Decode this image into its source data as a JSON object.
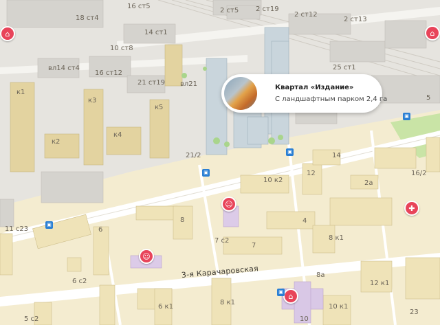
{
  "callout": {
    "title": "Квартал «Издание»",
    "subtitle": "С ландшафтным парком 2,4 га",
    "image_icon": "building-photo"
  },
  "streets": {
    "main_street": "3-я Карачаровская"
  },
  "building_labels": {
    "b_18ct4": "18 ст4",
    "b_16ct5": "16 ст5",
    "b_2ct19": "2 ст19",
    "b_14ct1": "14 ст1",
    "b_10ct8": "10 ст8",
    "b_2ct13": "2 ст13",
    "b_2ct5": "2 ст5",
    "b_2ct12": "2 ст12",
    "b_vl14ct4": "вл14 ст4",
    "b_16ct12": "16 ст12",
    "b_21ct19": "21 ст19",
    "b_vl21": "вл21",
    "b_25ct1": "25 ст1",
    "b_k1": "к1",
    "b_k3": "к3",
    "b_k5": "к5",
    "b_k2": "к2",
    "b_k4": "к4",
    "b_21_2": "21/2",
    "b_14": "14",
    "b_12": "12",
    "b_2a": "2а",
    "b_16_2": "16/2",
    "b_10k2": "10 к2",
    "b_6": "6",
    "b_8": "8",
    "b_7": "7",
    "b_8k1": "8 к1",
    "b_4": "4",
    "b_6k1": "6 к1",
    "b_6c2": "6 с2",
    "b_7c2": "7 с2",
    "b_11c23": "11 с23",
    "b_12k1": "12 к1",
    "b_8a": "8а",
    "b_10": "10",
    "b_10k1": "10 к1",
    "b_6k1b": "6 к1",
    "b_8k1b": "8 к1",
    "b_5c2": "5 с2",
    "b_23": "23",
    "b_5": "5"
  },
  "pois": {
    "kindergarten": "kindergarten-icon",
    "school": "school-icon",
    "pharmacy": "medical-bag-icon",
    "bus_stop": "bus-stop-icon"
  },
  "colors": {
    "roads": "#ffffff",
    "blocks": "#f4e9c6",
    "buildings": "#e3d6a8",
    "industrial": "#e4e2de",
    "park": "#c5e3a4",
    "poi_red": "#e8445a",
    "bus_blue": "#2a7fd4"
  }
}
